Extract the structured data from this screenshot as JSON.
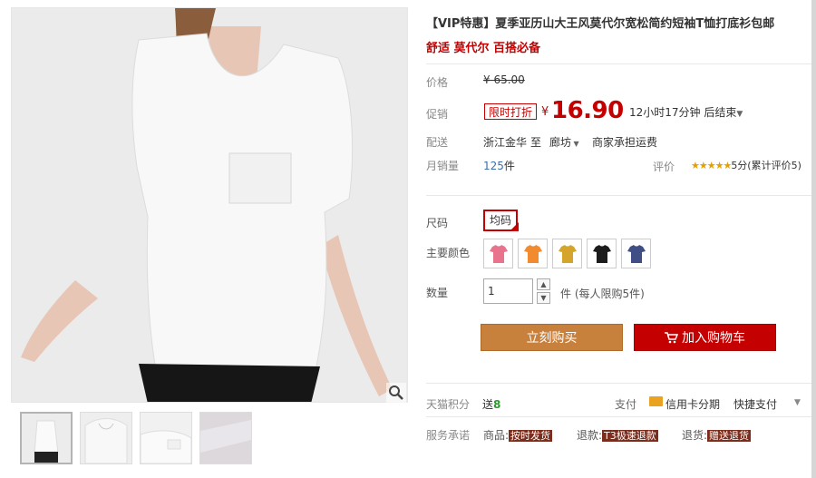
{
  "product": {
    "title": "【VIP特惠】夏季亚历山大王风莫代尔宽松简约短袖T恤打底衫包邮",
    "subtitle": "舒适 莫代尔 百搭必备"
  },
  "price": {
    "label": "价格",
    "original": "¥ 65.00"
  },
  "promo": {
    "label": "促销",
    "tag": "限时打折",
    "yen": "¥",
    "price": "16.90",
    "countdown": "12小时17分钟 后结束"
  },
  "shipping": {
    "label": "配送",
    "from": "浙江金华",
    "to_word": "至",
    "destination": "廊坊",
    "note": "商家承担运费"
  },
  "sales": {
    "label": "月销量",
    "count": "125",
    "unit": "件",
    "rating_label": "评价",
    "stars": "★★★★★",
    "rating_text": "5分(累计评价5)"
  },
  "options": {
    "size_label": "尺码",
    "size_value": "均码",
    "color_label": "主要颜色",
    "colors": [
      "#e8738c",
      "#f28a2e",
      "#d4a52a",
      "#1c1c1c",
      "#3f4f86"
    ]
  },
  "quantity": {
    "label": "数量",
    "value": "1",
    "hint": "件 (每人限购5件)"
  },
  "buttons": {
    "buy": "立刻购买",
    "cart": "加入购物车"
  },
  "points": {
    "label": "天猫积分",
    "give": "送",
    "value": "8"
  },
  "payment": {
    "label": "支付",
    "card": "信用卡分期",
    "quick": "快捷支付"
  },
  "service": {
    "label": "服务承诺",
    "item1_prefix": "商品:",
    "item1_tag": "按时发货",
    "item2_prefix": "退款:",
    "item2_tag": "T3极速退款",
    "item3_prefix": "退货:",
    "item3_tag": "赠送退货"
  }
}
